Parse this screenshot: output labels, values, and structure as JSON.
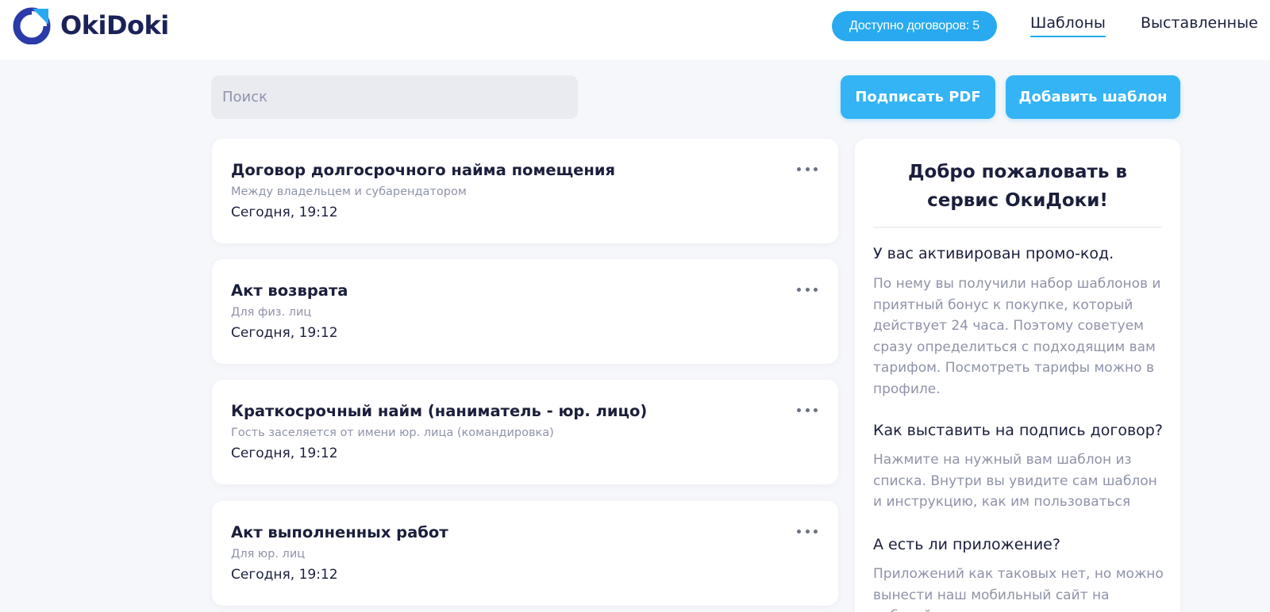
{
  "header": {
    "brand": "OkiDoki",
    "badge": "Доступно договоров: 5",
    "nav": {
      "templates": "Шаблоны",
      "issued": "Выставленные"
    }
  },
  "toolbar": {
    "search_placeholder": "Поиск",
    "sign_pdf_label": "Подписать PDF",
    "add_template_label": "Добавить шаблон"
  },
  "templates": [
    {
      "title": "Договор долгосрочного найма помещения",
      "subtitle": "Между владельцем и субарендатором",
      "date": "Сегодня, 19:12"
    },
    {
      "title": "Акт возврата",
      "subtitle": "Для физ. лиц",
      "date": "Сегодня, 19:12"
    },
    {
      "title": "Краткосрочный найм (наниматель - юр. лицо)",
      "subtitle": "Гость заселяется от имени юр. лица (командировка)",
      "date": "Сегодня, 19:12"
    },
    {
      "title": "Акт выполненных работ",
      "subtitle": "Для юр. лиц",
      "date": "Сегодня, 19:12"
    }
  ],
  "welcome": {
    "title": "Добро пожаловать в сервис ОкиДоки!",
    "sections": [
      {
        "heading": "У вас активирован промо-код.",
        "text": "По нему вы получили набор шаблонов и приятный бонус к покупке, который действует 24 часа. Поэтому советуем сразу определиться с подходящим вам тарифом. Посмотреть тарифы можно в профиле."
      },
      {
        "heading": "Как выставить на подпись договор?",
        "text": "Нажмите на нужный вам шаблон из списка. Внутри вы увидите сам шаблон и инструкцию, как им пользоваться"
      },
      {
        "heading": "А есть ли приложение?",
        "text": "Приложений как таковых нет, но можно вынести наш мобильный сайт на рабочий"
      }
    ]
  },
  "colors": {
    "accent": "#29aaf0",
    "button": "#34b4f5",
    "brand_dark": "#1b2258",
    "muted_text": "#8f93a8",
    "background": "#f6f7fa"
  },
  "icons": {
    "logo": "okidoki-logo-icon",
    "card_menu": "more-horizontal-icon"
  }
}
